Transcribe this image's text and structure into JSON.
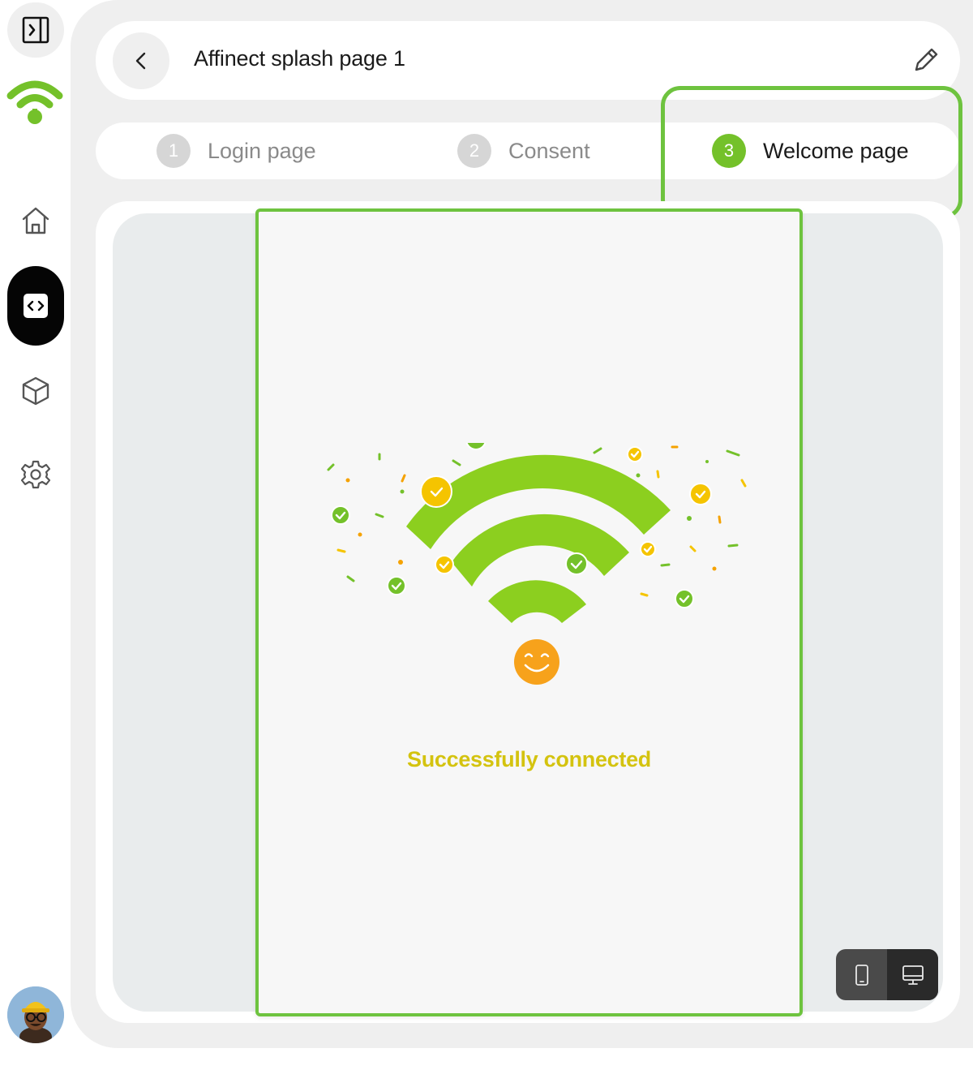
{
  "header": {
    "title": "Affinect splash page 1"
  },
  "steps": [
    {
      "number": "1",
      "label": "Login page",
      "active": false
    },
    {
      "number": "2",
      "label": "Consent",
      "active": false
    },
    {
      "number": "3",
      "label": "Welcome page",
      "active": true
    }
  ],
  "preview": {
    "message": "Successfully connected"
  },
  "sidebar": {
    "items": [
      {
        "icon": "sidebar-toggle-icon"
      },
      {
        "icon": "wifi-logo"
      },
      {
        "icon": "home-icon"
      },
      {
        "icon": "code-icon",
        "active": true
      },
      {
        "icon": "cube-icon"
      },
      {
        "icon": "gear-icon"
      }
    ]
  },
  "device_toggle": {
    "options": [
      "mobile-icon",
      "desktop-icon"
    ],
    "selected": "desktop-icon"
  },
  "colors": {
    "accent_green": "#74c12a",
    "highlight_border": "#6ec33f",
    "wifi_green": "#8ccf1f",
    "smiley_orange": "#f7a21b",
    "success_text": "#d4c30f"
  }
}
